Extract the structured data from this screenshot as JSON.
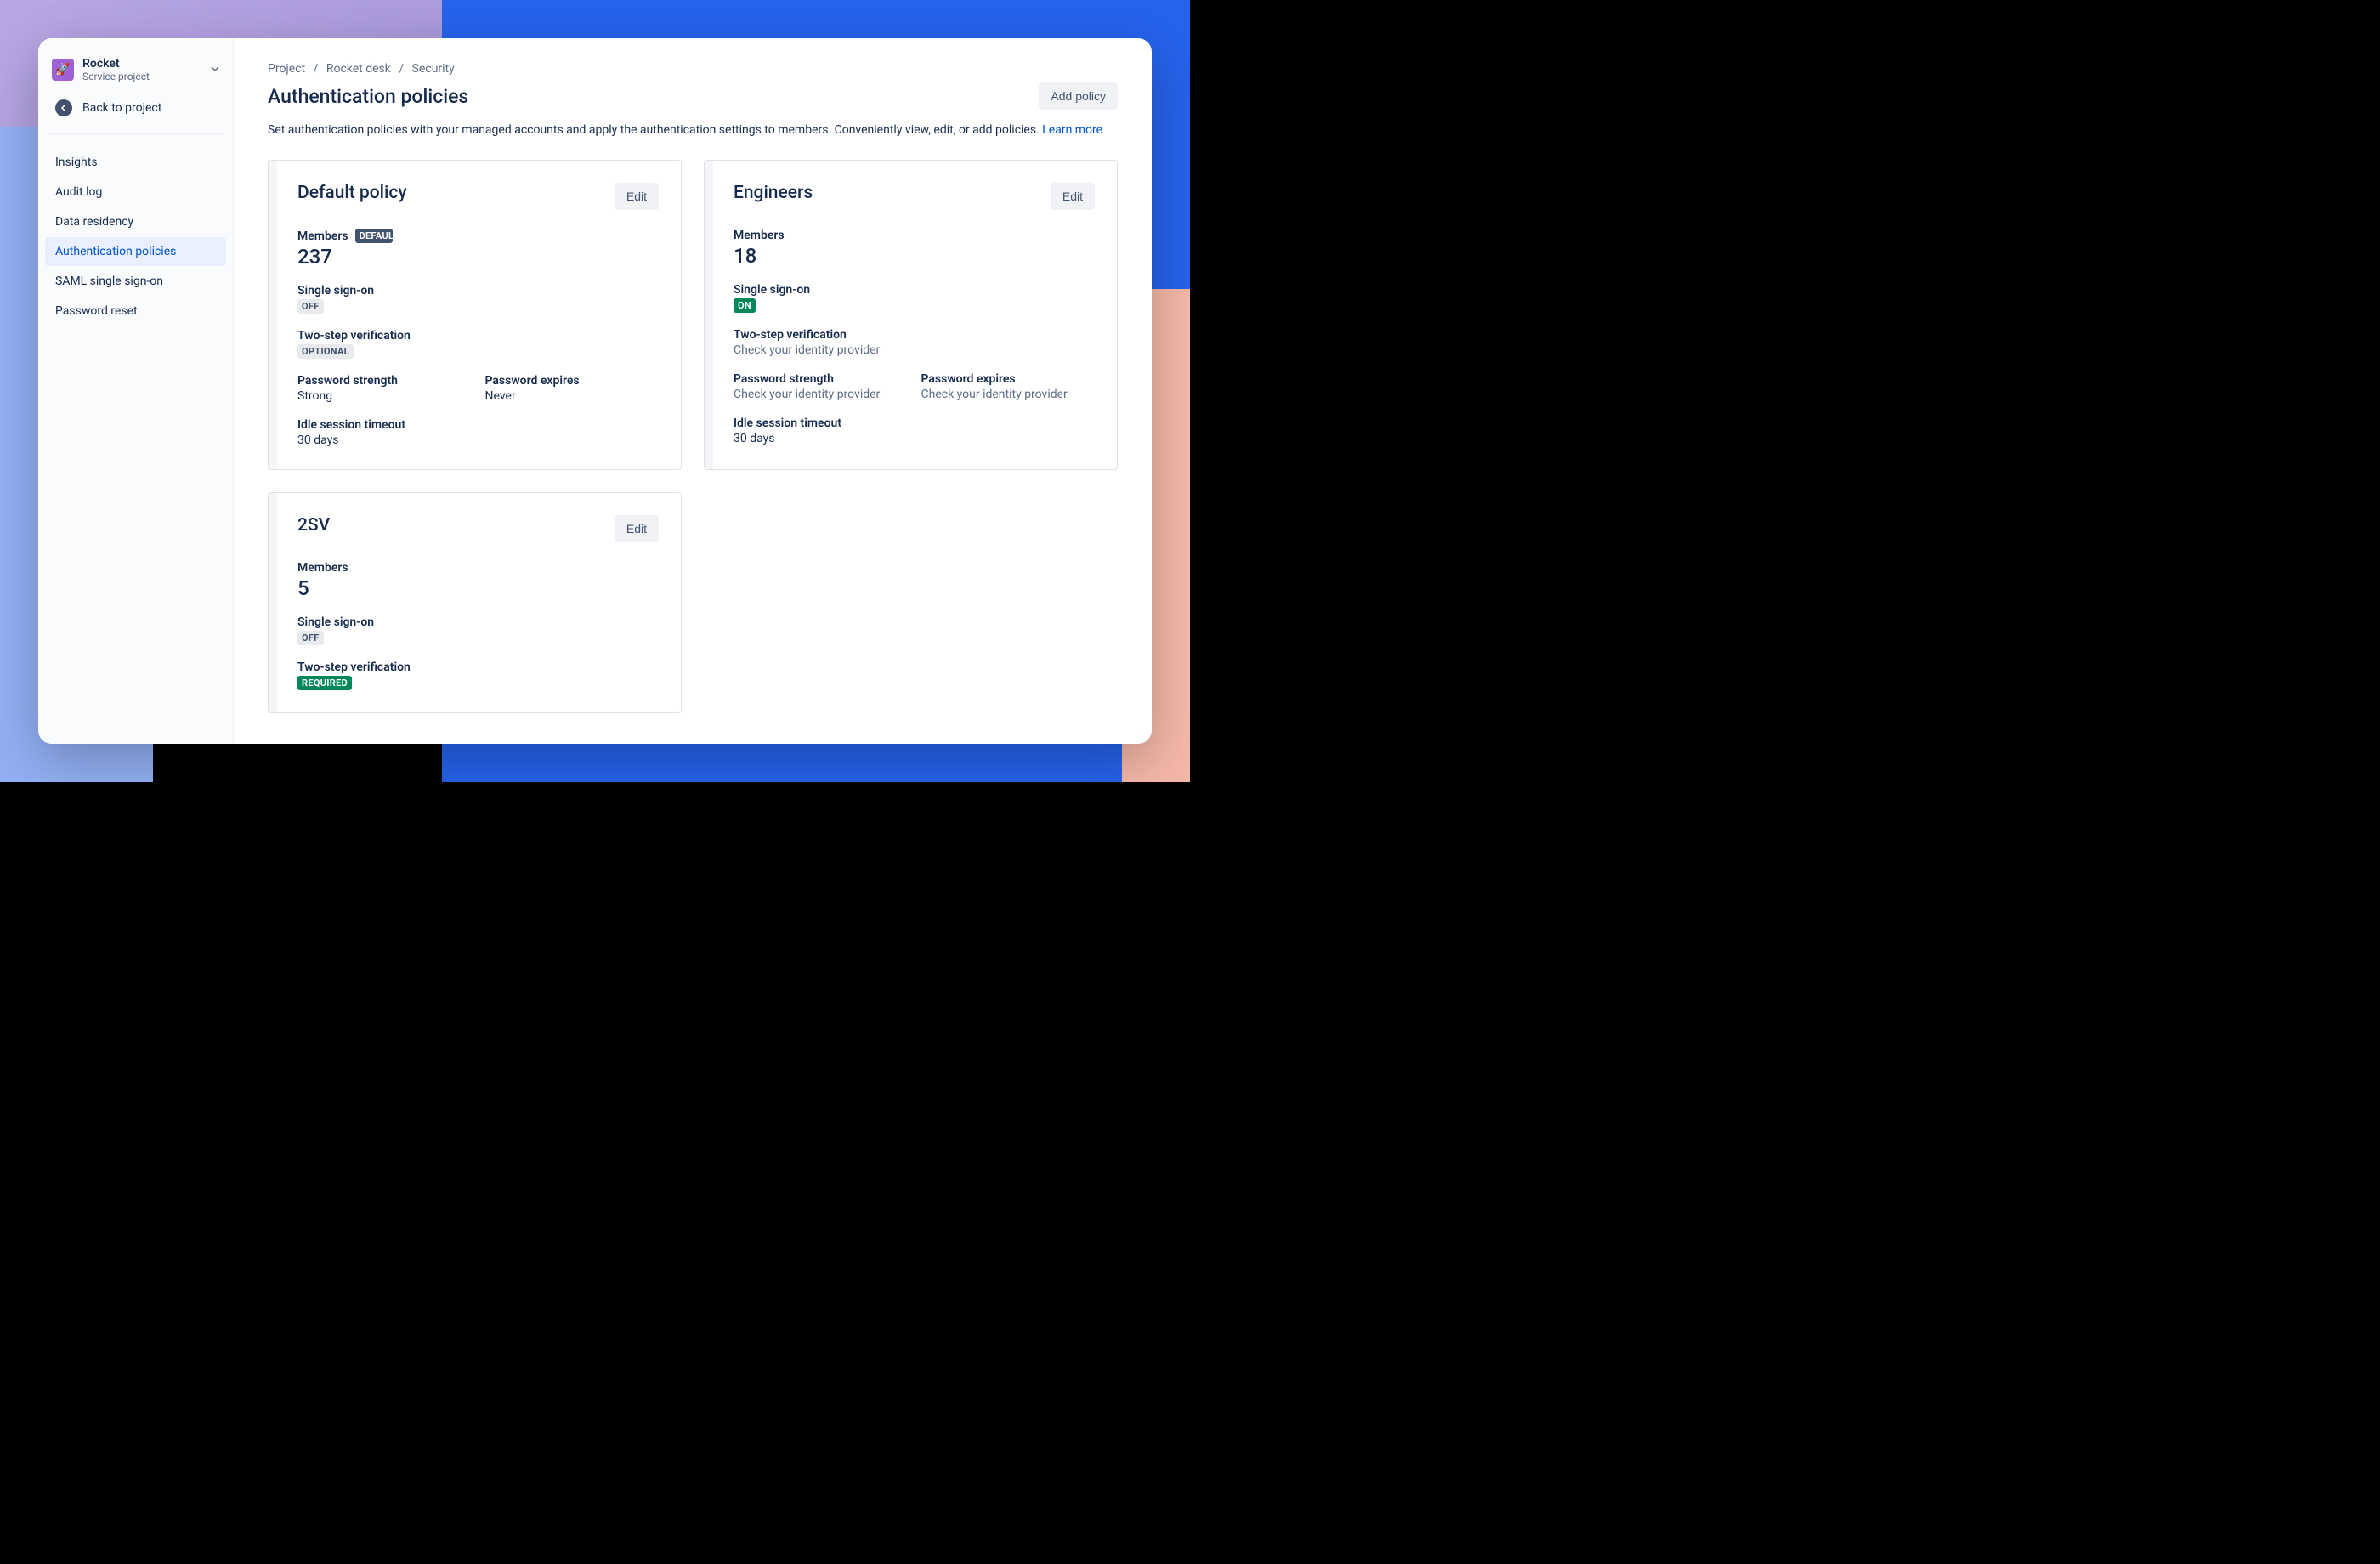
{
  "project": {
    "name": "Rocket",
    "subtitle": "Service project"
  },
  "back_link": "Back to project",
  "sidebar": {
    "items": [
      {
        "label": "Insights"
      },
      {
        "label": "Audit log"
      },
      {
        "label": "Data residency"
      },
      {
        "label": "Authentication policies"
      },
      {
        "label": "SAML single sign-on"
      },
      {
        "label": "Password reset"
      }
    ]
  },
  "breadcrumb": {
    "0": "Project",
    "1": "Rocket desk",
    "2": "Security"
  },
  "page": {
    "title": "Authentication policies",
    "add_button": "Add policy",
    "description": "Set authentication policies with your managed accounts and apply the authentication settings to members. Conveniently view, edit, or add policies. ",
    "learn_more": "Learn more"
  },
  "labels": {
    "members": "Members",
    "default": "DEFAULT",
    "sso": "Single sign-on",
    "twostep": "Two-step verification",
    "pw_strength": "Password strength",
    "pw_expires": "Password expires",
    "idle": "Idle session timeout",
    "edit": "Edit",
    "check_idp": "Check your identity provider"
  },
  "policies": [
    {
      "name": "Default policy",
      "is_default": true,
      "members": "237",
      "sso_badge": "OFF",
      "sso_badge_class": "badge-gray",
      "twostep_badge": "OPTIONAL",
      "twostep_badge_class": "badge-gray",
      "pw_strength": "Strong",
      "pw_expires": "Never",
      "idle": "30 days"
    },
    {
      "name": "Engineers",
      "is_default": false,
      "members": "18",
      "sso_badge": "ON",
      "sso_badge_class": "badge-green",
      "twostep_text": "Check your identity provider",
      "pw_strength_text": "Check your identity provider",
      "pw_expires_text": "Check your identity provider",
      "idle": "30 days"
    },
    {
      "name": "2SV",
      "is_default": false,
      "members": "5",
      "sso_badge": "OFF",
      "sso_badge_class": "badge-gray",
      "twostep_badge": "REQUIRED",
      "twostep_badge_class": "badge-green"
    }
  ]
}
